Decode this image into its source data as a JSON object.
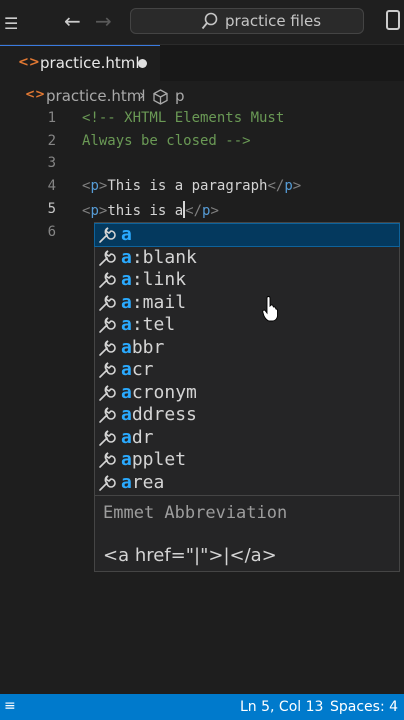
{
  "titlebar": {
    "search_text": "practice files",
    "menu_glyph": "☰"
  },
  "nav": {
    "back": "←",
    "forward": "→"
  },
  "tab": {
    "label": "practice.html",
    "icon": "<>"
  },
  "breadcrumb": {
    "file": "practice.html",
    "separator": "›",
    "symbol": "p",
    "icon": "<>"
  },
  "editor": {
    "line_numbers": [
      "1",
      "2",
      "3",
      "4",
      "5",
      "6"
    ],
    "line1": "<!-- XHTML Elements Must",
    "line2": "Always be closed -->",
    "line4_text": "This is a paragraph",
    "line5_text": "this is a",
    "open_bracket": "<",
    "close_bracket": ">",
    "close_slash": "</",
    "tag_p": "p"
  },
  "suggest": {
    "items": [
      {
        "match": "a",
        "rest": ""
      },
      {
        "match": "a",
        "rest": ":blank"
      },
      {
        "match": "a",
        "rest": ":link"
      },
      {
        "match": "a",
        "rest": ":mail"
      },
      {
        "match": "a",
        "rest": ":tel"
      },
      {
        "match": "a",
        "rest": "bbr"
      },
      {
        "match": "a",
        "rest": "cr"
      },
      {
        "match": "a",
        "rest": "cronym"
      },
      {
        "match": "a",
        "rest": "ddress"
      },
      {
        "match": "a",
        "rest": "dr"
      },
      {
        "match": "a",
        "rest": "pplet"
      },
      {
        "match": "a",
        "rest": "rea"
      }
    ],
    "detail_title": "Emmet Abbreviation",
    "detail_code": "<a href=\"|\">|</a>"
  },
  "status": {
    "left_icon": "≡",
    "position": "Ln 5, Col 13",
    "spaces": "Spaces: 4"
  },
  "colors": {
    "accent": "#007acc",
    "selection": "#04395e",
    "match": "#2aaaff",
    "html_icon": "#e37933"
  }
}
